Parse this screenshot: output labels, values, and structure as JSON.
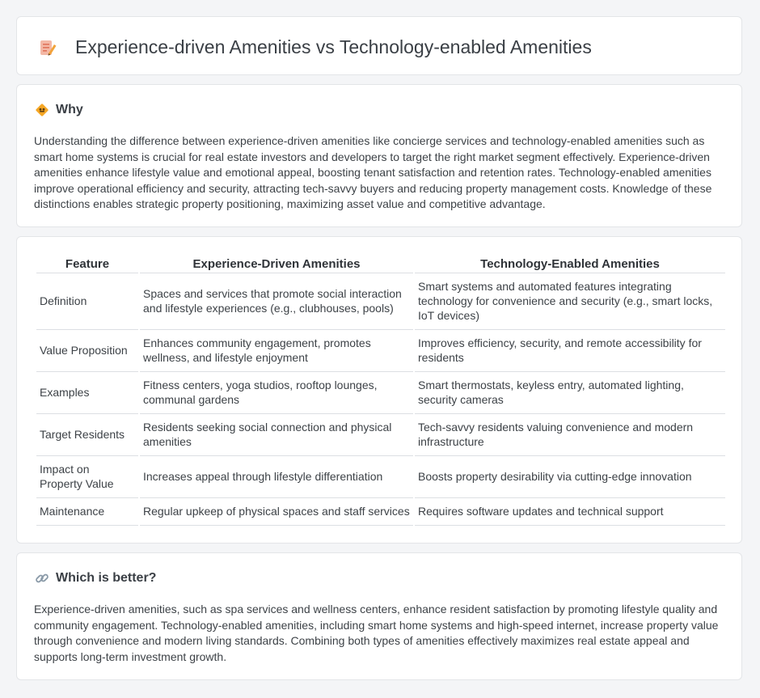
{
  "header": {
    "title": "Experience-driven Amenities vs Technology-enabled Amenities",
    "icon": "document-edit-icon"
  },
  "why": {
    "icon": "diamond-sign-icon",
    "title": "Why",
    "text": "Understanding the difference between experience-driven amenities like concierge services and technology-enabled amenities such as smart home systems is crucial for real estate investors and developers to target the right market segment effectively. Experience-driven amenities enhance lifestyle value and emotional appeal, boosting tenant satisfaction and retention rates. Technology-enabled amenities improve operational efficiency and security, attracting tech-savvy buyers and reducing property management costs. Knowledge of these distinctions enables strategic property positioning, maximizing asset value and competitive advantage."
  },
  "table": {
    "headers": [
      "Feature",
      "Experience-Driven Amenities",
      "Technology-Enabled Amenities"
    ],
    "rows": [
      [
        "Definition",
        "Spaces and services that promote social interaction and lifestyle experiences (e.g., clubhouses, pools)",
        "Smart systems and automated features integrating technology for convenience and security (e.g., smart locks, IoT devices)"
      ],
      [
        "Value Proposition",
        "Enhances community engagement, promotes wellness, and lifestyle enjoyment",
        "Improves efficiency, security, and remote accessibility for residents"
      ],
      [
        "Examples",
        "Fitness centers, yoga studios, rooftop lounges, communal gardens",
        "Smart thermostats, keyless entry, automated lighting, security cameras"
      ],
      [
        "Target Residents",
        "Residents seeking social connection and physical amenities",
        "Tech-savvy residents valuing convenience and modern infrastructure"
      ],
      [
        "Impact on Property Value",
        "Increases appeal through lifestyle differentiation",
        "Boosts property desirability via cutting-edge innovation"
      ],
      [
        "Maintenance",
        "Regular upkeep of physical spaces and staff services",
        "Requires software updates and technical support"
      ]
    ]
  },
  "better": {
    "icon": "link-icon",
    "title": "Which is better?",
    "text": "Experience-driven amenities, such as spa services and wellness centers, enhance resident satisfaction by promoting lifestyle quality and community engagement. Technology-enabled amenities, including smart home systems and high-speed internet, increase property value through convenience and modern living standards. Combining both types of amenities effectively maximizes real estate appeal and supports long-term investment growth."
  }
}
